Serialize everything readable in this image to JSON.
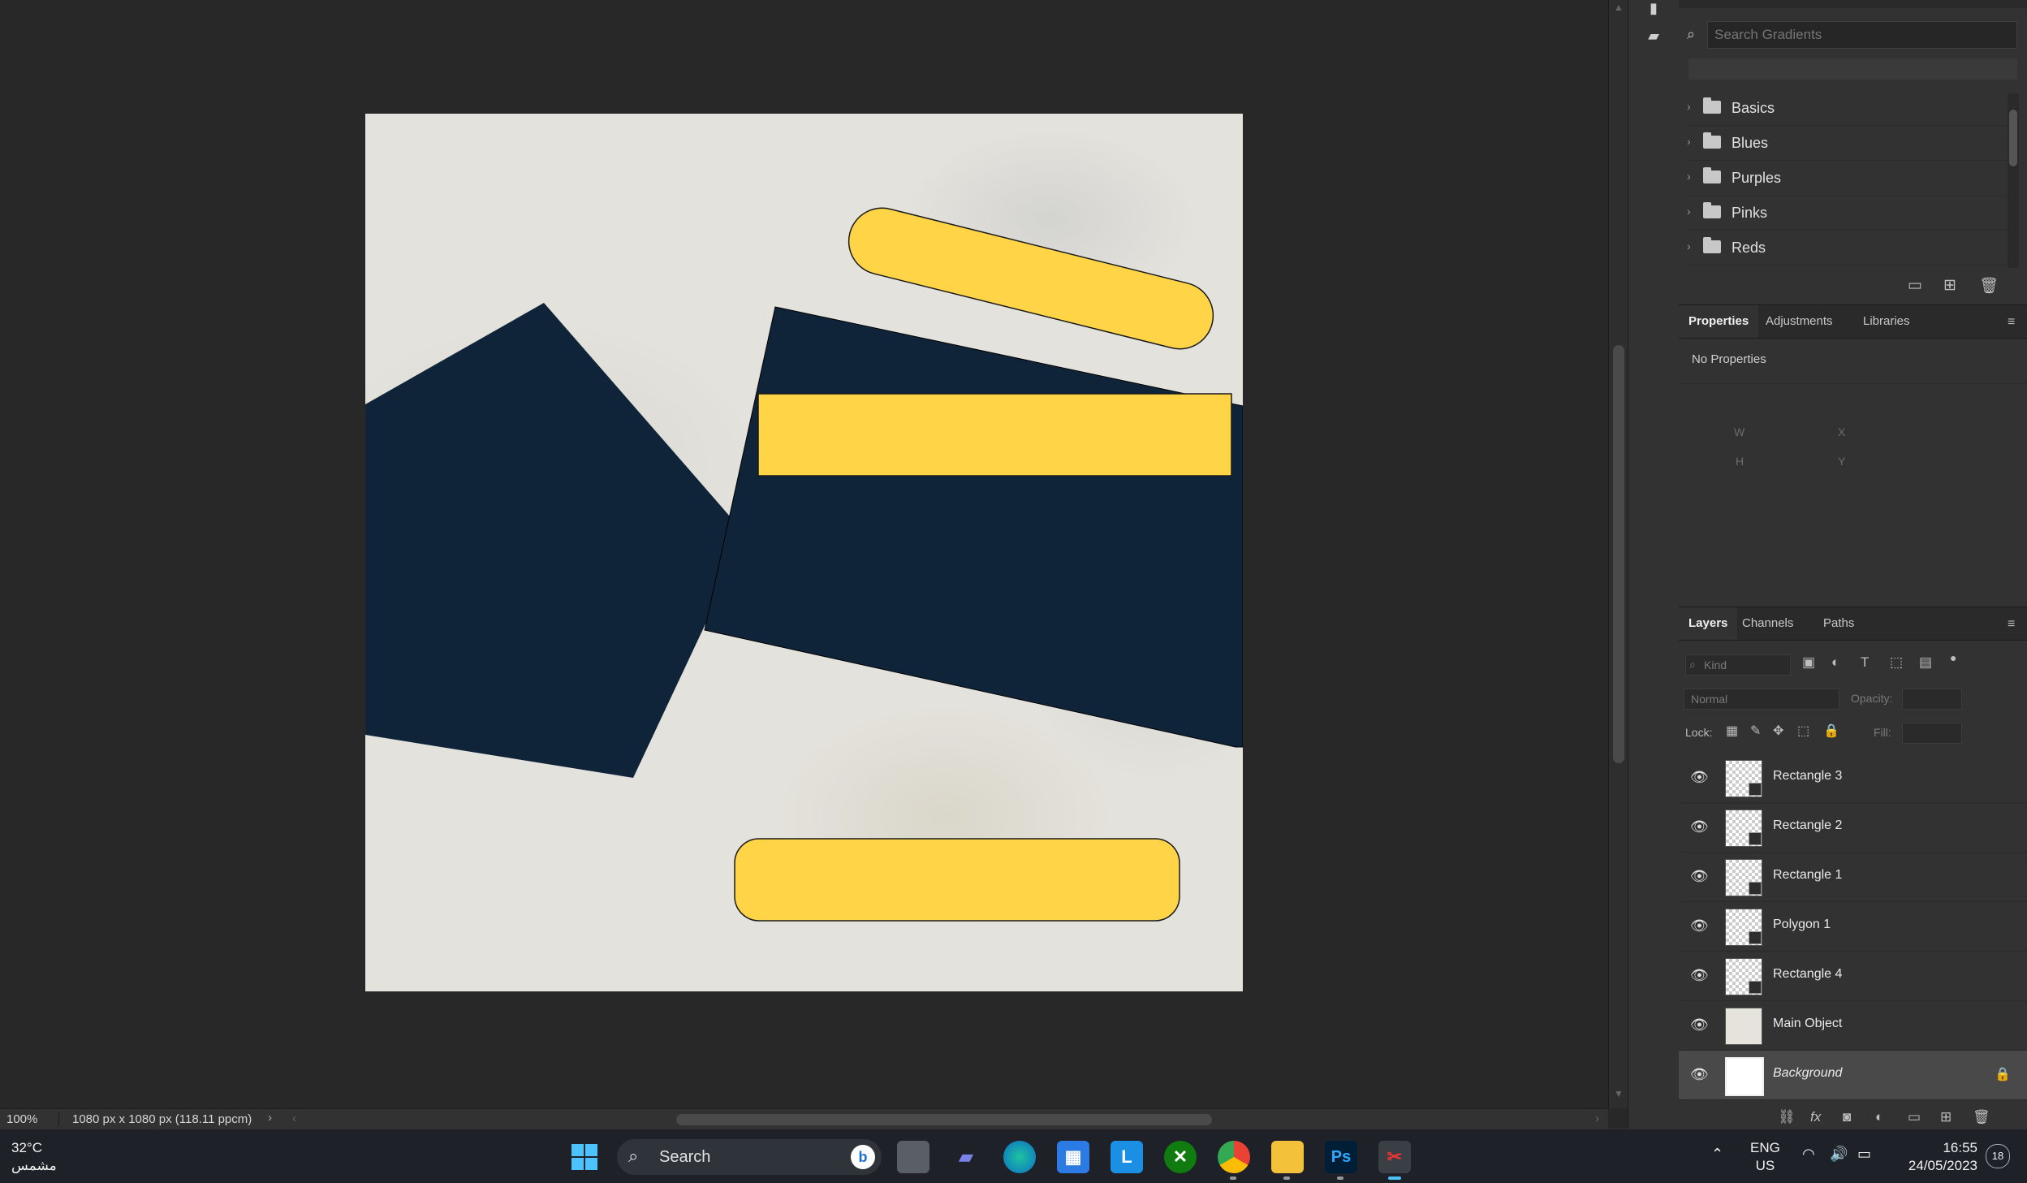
{
  "gradients": {
    "search_placeholder": "Search Gradients",
    "folders": [
      "Basics",
      "Blues",
      "Purples",
      "Pinks",
      "Reds"
    ]
  },
  "properties": {
    "tabs": [
      "Properties",
      "Adjustments",
      "Libraries"
    ],
    "empty_text": "No Properties",
    "labels": {
      "w": "W",
      "h": "H",
      "x": "X",
      "y": "Y"
    }
  },
  "layers": {
    "tabs": [
      "Layers",
      "Channels",
      "Paths"
    ],
    "kind_placeholder": "Kind",
    "blend_mode": "Normal",
    "opacity_label": "Opacity:",
    "lock_label": "Lock:",
    "fill_label": "Fill:",
    "items": [
      {
        "name": "Rectangle 3"
      },
      {
        "name": "Rectangle 2"
      },
      {
        "name": "Rectangle 1"
      },
      {
        "name": "Polygon 1"
      },
      {
        "name": "Rectangle 4"
      },
      {
        "name": "Main Object"
      },
      {
        "name": "Background"
      }
    ]
  },
  "status": {
    "zoom": "100%",
    "doc_info": "1080 px x 1080 px (118.11 ppcm)"
  },
  "canvas": {
    "colors": {
      "navy": "#0f2439",
      "yellow": "#ffd447",
      "marble": "#e4e2dc"
    }
  },
  "taskbar": {
    "weather_temp": "32°C",
    "weather_desc": "مشمس",
    "search_label": "Search",
    "lang_top": "ENG",
    "lang_bottom": "US",
    "time": "16:55",
    "date": "24/05/2023",
    "notification_count": "18"
  }
}
